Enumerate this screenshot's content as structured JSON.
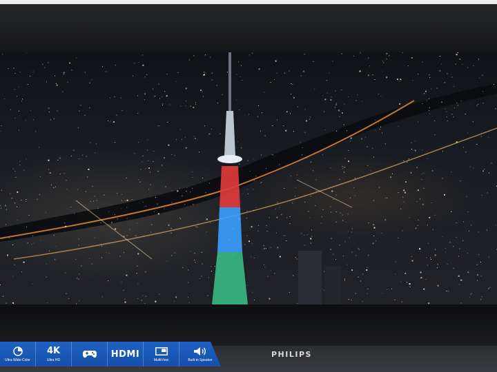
{
  "tv": {
    "brand": "PHILIPS",
    "colors": {
      "panel_blue": "#1e62c5",
      "bezel": "#151618"
    }
  },
  "features": [
    {
      "icon": "color-swirl-icon",
      "label": "",
      "caption": "Ultra Wide-Color"
    },
    {
      "icon": "4k-label",
      "label": "4K",
      "caption": "Ultra HD"
    },
    {
      "icon": "gamepad-icon",
      "label": "",
      "caption": ""
    },
    {
      "icon": "hdmi-label",
      "label": "HDMI",
      "caption": ""
    },
    {
      "icon": "multiview-icon",
      "label": "",
      "caption": "MultiView"
    },
    {
      "icon": "speaker-icon",
      "label": "",
      "caption": "Built-in Speaker"
    }
  ],
  "screen_content": {
    "subject": "tower-at-night",
    "tower_colors": {
      "top": "#d8e4f0",
      "red_band": "#e23b3b",
      "blue_band": "#3aa0ff",
      "green_base": "#39c28a"
    },
    "city_light_color": "#ffd9a0",
    "river_light_color": "#ff9a3c"
  }
}
